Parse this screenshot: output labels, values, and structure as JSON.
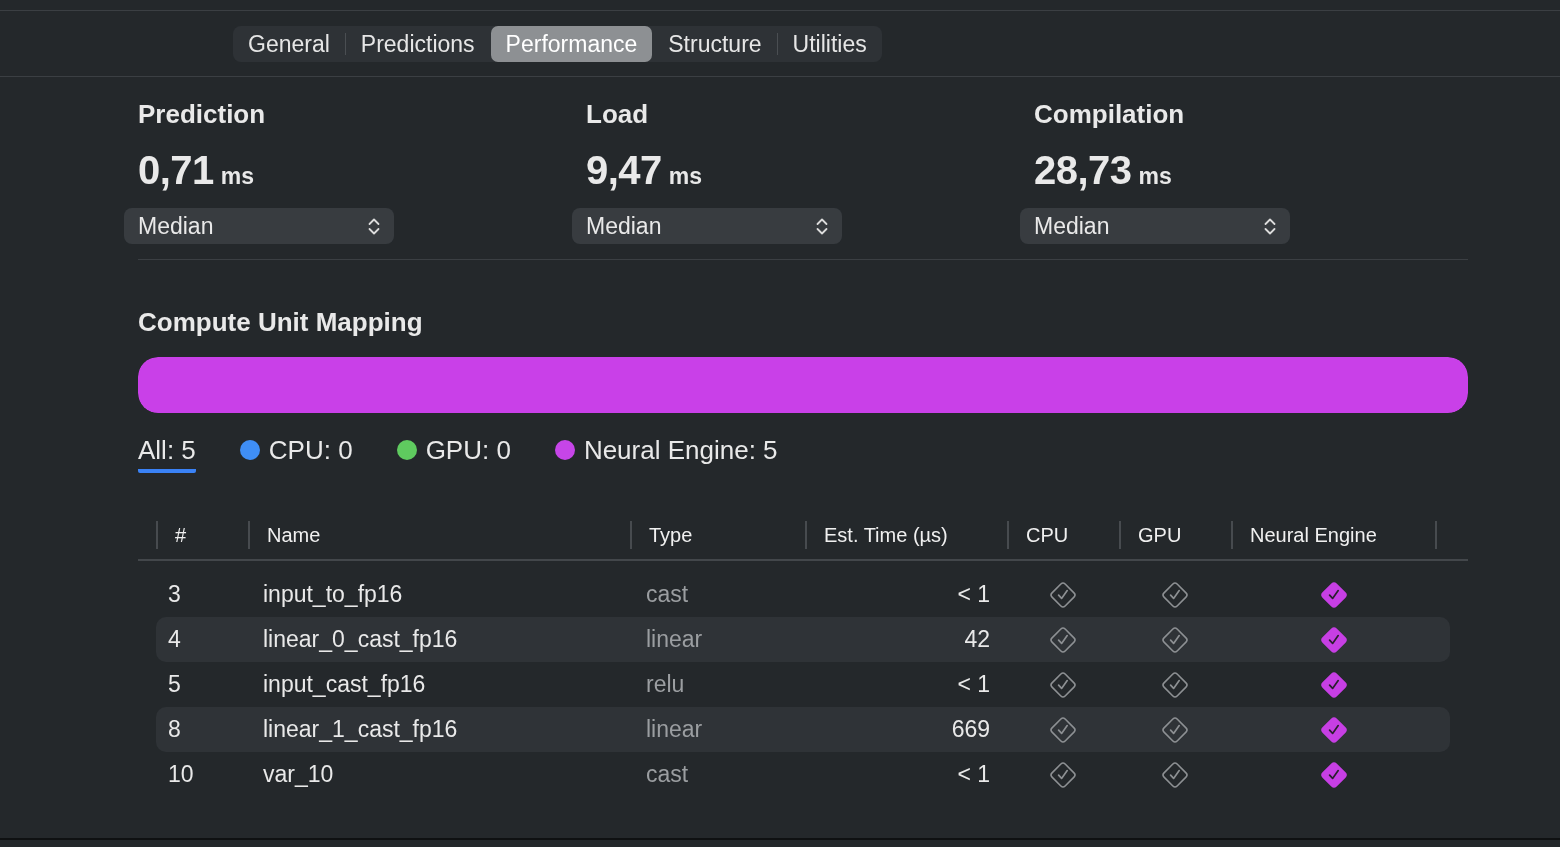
{
  "tabs": [
    {
      "label": "General",
      "selected": false
    },
    {
      "label": "Predictions",
      "selected": false
    },
    {
      "label": "Performance",
      "selected": true
    },
    {
      "label": "Structure",
      "selected": false
    },
    {
      "label": "Utilities",
      "selected": false
    }
  ],
  "metrics": [
    {
      "title": "Prediction",
      "value": "0,71",
      "unit": "ms",
      "statistic": "Median"
    },
    {
      "title": "Load",
      "value": "9,47",
      "unit": "ms",
      "statistic": "Median"
    },
    {
      "title": "Compilation",
      "value": "28,73",
      "unit": "ms",
      "statistic": "Median"
    }
  ],
  "compute_unit_mapping": {
    "title": "Compute Unit Mapping",
    "mapping_bar": {
      "color": "#c940e8",
      "level": 1
    },
    "filters": [
      {
        "label": "All: 5",
        "selected": true
      },
      {
        "label": "CPU: 0",
        "color": "#3f8ef5",
        "selected": false
      },
      {
        "label": "GPU: 0",
        "color": "#5fcb5f",
        "selected": false
      },
      {
        "label": "Neural Engine: 5",
        "color": "#c645e8",
        "selected": false
      }
    ]
  },
  "table": {
    "columns": [
      "#",
      "Name",
      "Type",
      "Est. Time (µs)",
      "CPU",
      "GPU",
      "Neural Engine"
    ],
    "rows": [
      {
        "index": "3",
        "name": "input_to_fp16",
        "type": "cast",
        "time": "< 1",
        "units": [
          {
            "selected": false
          },
          {
            "selected": false
          },
          {
            "selected": true
          }
        ]
      },
      {
        "index": "4",
        "name": "linear_0_cast_fp16",
        "type": "linear",
        "time": "42",
        "units": [
          {
            "selected": false
          },
          {
            "selected": false
          },
          {
            "selected": true
          }
        ]
      },
      {
        "index": "5",
        "name": "input_cast_fp16",
        "type": "relu",
        "time": "< 1",
        "units": [
          {
            "selected": false
          },
          {
            "selected": false
          },
          {
            "selected": true
          }
        ]
      },
      {
        "index": "8",
        "name": "linear_1_cast_fp16",
        "type": "linear",
        "time": "669",
        "units": [
          {
            "selected": false
          },
          {
            "selected": false
          },
          {
            "selected": true
          }
        ]
      },
      {
        "index": "10",
        "name": "var_10",
        "type": "cast",
        "time": "< 1",
        "units": [
          {
            "selected": false
          },
          {
            "selected": false
          },
          {
            "selected": true
          }
        ]
      }
    ]
  }
}
